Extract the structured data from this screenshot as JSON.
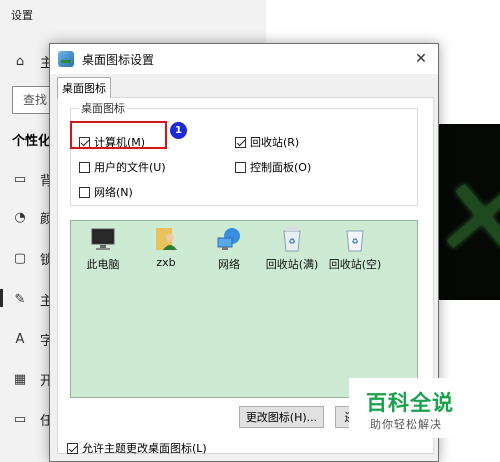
{
  "settings": {
    "title": "设置",
    "home_label": "主",
    "search_placeholder": "查找",
    "section_title": "个性化",
    "nav": [
      {
        "icon": "image-icon",
        "glyph": "▭",
        "label": "背"
      },
      {
        "icon": "palette-icon",
        "glyph": "◔",
        "label": "颜"
      },
      {
        "icon": "lockscreen-icon",
        "glyph": "▢",
        "label": "锁"
      },
      {
        "icon": "theme-icon",
        "glyph": "✎",
        "label": "主"
      },
      {
        "icon": "font-icon",
        "glyph": "A",
        "label": "字"
      },
      {
        "icon": "start-icon",
        "glyph": "▦",
        "label": "开"
      },
      {
        "icon": "taskbar-icon",
        "glyph": "▭",
        "label": "任"
      }
    ]
  },
  "dialog": {
    "title": "桌面图标设置",
    "tab_label": "桌面图标",
    "group_label": "桌面图标",
    "checkboxes": [
      {
        "label": "计算机(M)",
        "checked": true
      },
      {
        "label": "回收站(R)",
        "checked": true
      },
      {
        "label": "用户的文件(U)",
        "checked": false
      },
      {
        "label": "控制面板(O)",
        "checked": false
      },
      {
        "label": "网络(N)",
        "checked": false
      }
    ],
    "badge_number": "1",
    "icons": [
      {
        "name": "computer-icon",
        "label": "此电脑"
      },
      {
        "name": "user-folder-icon",
        "label": "zxb"
      },
      {
        "name": "network-icon",
        "label": "网络"
      },
      {
        "name": "recycle-bin-full-icon",
        "label": "回收站(满)"
      },
      {
        "name": "recycle-bin-empty-icon",
        "label": "回收站(空)"
      }
    ],
    "change_icon_button": "更改图标(H)...",
    "restore_button": "还",
    "allow_theme_label": "允许主题更改桌面图标(L)",
    "allow_theme_checked": true
  },
  "watermark": {
    "title": "百科全说",
    "subtitle": "助你轻松解决"
  },
  "colors": {
    "icon_area_bg": "#cdebd2",
    "highlight": "#d9141a",
    "badge": "#1a2bd6",
    "watermark_green": "#18a24c"
  }
}
